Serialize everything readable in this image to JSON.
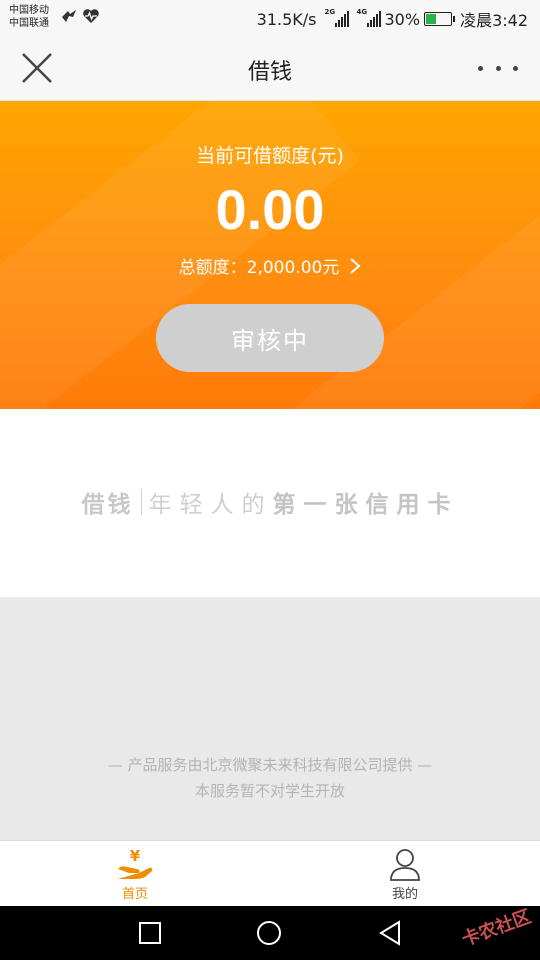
{
  "status_bar": {
    "carrier_1": "中国移动",
    "carrier_2": "中国联通",
    "net_speed": "31.5K/s",
    "signal_tag_1": "2G",
    "signal_tag_2": "4G",
    "battery": "30%",
    "time": "凌晨3:42"
  },
  "nav": {
    "title": "借钱"
  },
  "hero": {
    "label": "当前可借额度(元)",
    "amount": "0.00",
    "total_label": "总额度：",
    "total_value": "2,000.00元",
    "review_button": "审核中"
  },
  "slogan": {
    "brand": "借钱",
    "part1": "年轻人的",
    "part2": "第一张信用卡"
  },
  "footer": {
    "line1": "— 产品服务由北京微聚未来科技有限公司提供 —",
    "line2": "本服务暂不对学生开放"
  },
  "tabs": [
    {
      "label": "首页",
      "icon": "home-yen-hand-icon",
      "active": true
    },
    {
      "label": "我的",
      "icon": "user-icon",
      "active": false
    }
  ],
  "watermark": "卡农社区",
  "colors": {
    "accent": "#ff8c10",
    "tab_active": "#f08c00",
    "button_disabled": "#cfcfcf"
  }
}
